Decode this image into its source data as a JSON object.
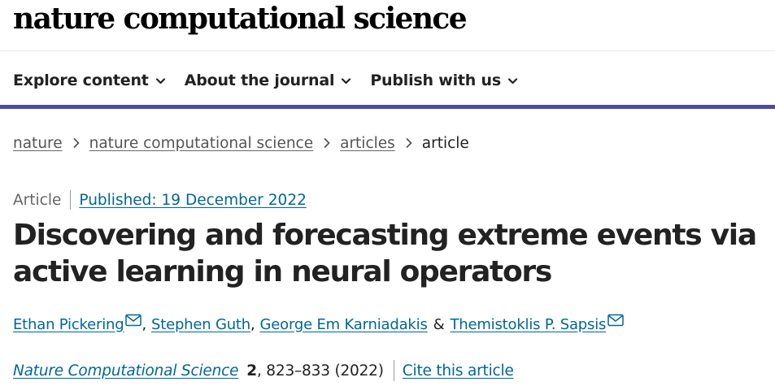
{
  "site": {
    "brand": "nature computational science"
  },
  "nav": {
    "items": [
      {
        "label": "Explore content"
      },
      {
        "label": "About the journal"
      },
      {
        "label": "Publish with us"
      }
    ]
  },
  "breadcrumb": {
    "items": [
      "nature",
      "nature computational science",
      "articles"
    ],
    "current": "article"
  },
  "article": {
    "type": "Article",
    "published": "Published: 19 December 2022",
    "title": "Discovering and forecasting extreme events via active learning in neural operators",
    "authors": [
      {
        "name": "Ethan Pickering",
        "email_icon": "mail-icon"
      },
      {
        "name": "Stephen Guth"
      },
      {
        "name": "George Em Karniadakis"
      },
      {
        "name": "Themistoklis P. Sapsis",
        "email_icon": "mail-icon"
      }
    ],
    "author_separator": ",",
    "author_conjunction": "&",
    "citation": {
      "journal": "Nature Computational Science",
      "volume": "2",
      "pages_year": ", 823–833 (2022)",
      "cite_label": "Cite this article"
    }
  },
  "colors": {
    "accent_bar": "#4f4a9e",
    "link": "#006699"
  }
}
